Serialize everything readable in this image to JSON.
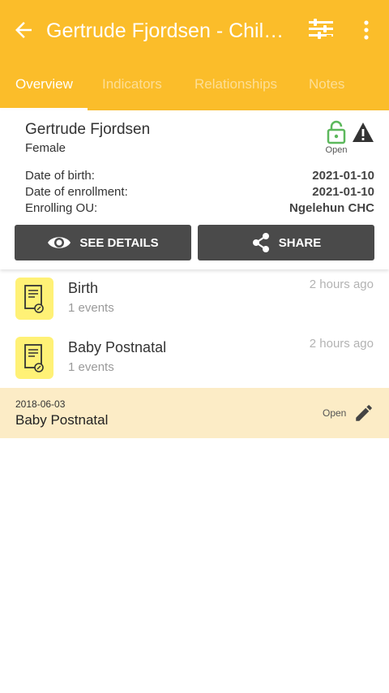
{
  "header": {
    "title": "Gertrude Fjordsen - Child Programme",
    "background": "#fbbd2a",
    "icons": [
      "arrow-back-icon",
      "filter-icon",
      "more-vert-icon"
    ]
  },
  "tabs": [
    {
      "label": "Overview",
      "active": true
    },
    {
      "label": "Indicators",
      "active": false
    },
    {
      "label": "Relationships",
      "active": false
    },
    {
      "label": "Notes",
      "active": false
    }
  ],
  "profile": {
    "name": "Gertrude Fjordsen",
    "sex": "Female",
    "status_label": "Open",
    "status_color": "#5cb85c",
    "fields": [
      {
        "label": "Date of birth:",
        "value": "2021-01-10"
      },
      {
        "label": "Date of enrollment:",
        "value": "2021-01-10"
      },
      {
        "label": "Enrolling OU:",
        "value": "Ngelehun CHC"
      }
    ],
    "buttons": {
      "details": "SEE DETAILS",
      "share": "SHARE"
    }
  },
  "stages": [
    {
      "name": "Birth",
      "count": "1 events",
      "time": "2 hours ago"
    },
    {
      "name": "Baby Postnatal",
      "count": "1 events",
      "time": "2 hours ago"
    }
  ],
  "event": {
    "date": "2018-06-03",
    "name": "Baby Postnatal",
    "status": "Open"
  }
}
